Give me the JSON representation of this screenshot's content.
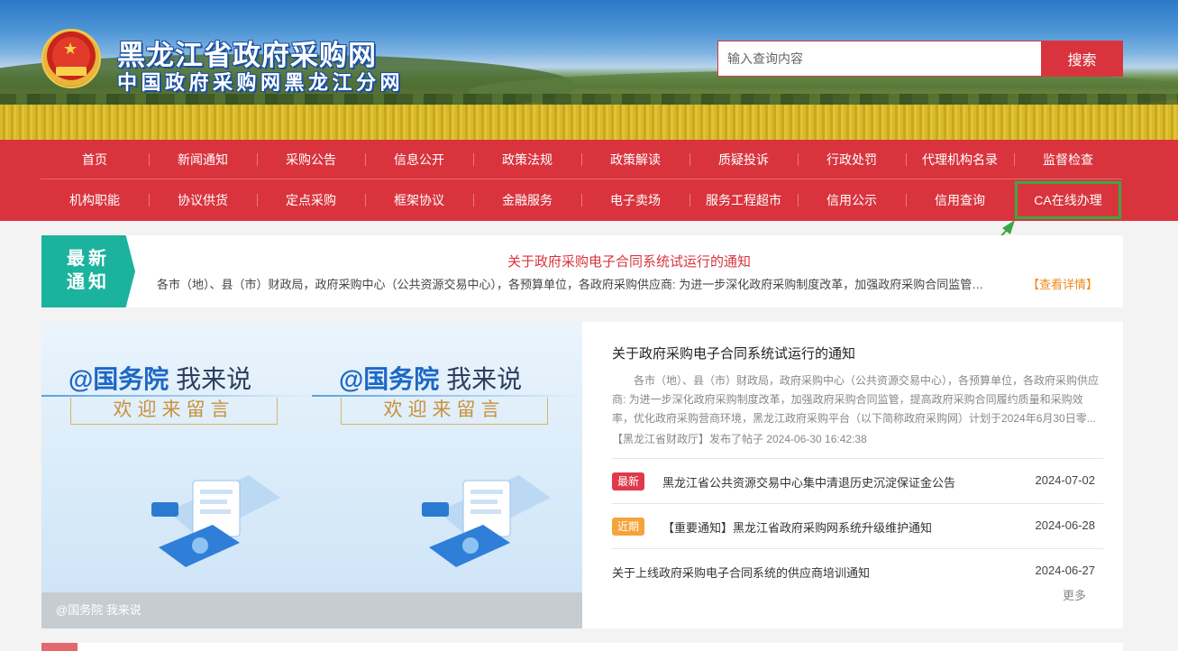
{
  "header": {
    "site_title": "黑龙江省政府采购网",
    "site_subtitle": "中国政府采购网黑龙江分网",
    "search_placeholder": "输入查询内容",
    "search_button": "搜索"
  },
  "nav": {
    "row1": [
      "首页",
      "新闻通知",
      "采购公告",
      "信息公开",
      "政策法规",
      "政策解读",
      "质疑投诉",
      "行政处罚",
      "代理机构名录",
      "监督检查"
    ],
    "row2": [
      "机构职能",
      "协议供货",
      "定点采购",
      "框架协议",
      "金融服务",
      "电子卖场",
      "服务工程超市",
      "信用公示",
      "信用查询",
      "CA在线办理"
    ]
  },
  "notice": {
    "tag_line1": "最新",
    "tag_line2": "通知",
    "title": "关于政府采购电子合同系统试运行的通知",
    "body": "各市（地）、县（市）财政局，政府采购中心（公共资源交易中心），各预算单位，各政府采购供应商: 为进一步深化政府采购制度改革，加强政府采购合同监管，提高政府采购合同履约质量和采购效率",
    "more": "【查看详情】"
  },
  "slider": {
    "title_main": "@国务院",
    "title_rest": " 我来说",
    "subtitle": "欢迎来留言",
    "caption": "@国务院 我来说"
  },
  "news": {
    "headline": "关于政府采购电子合同系统试运行的通知",
    "summary": "各市（地）、县（市）财政局，政府采购中心（公共资源交易中心），各预算单位，各政府采购供应商: 为进一步深化政府采购制度改革，加强政府采购合同监管，提高政府采购合同履约质量和采购效率，优化政府采购营商环境，黑龙江政府采购平台（以下简称政府采购网）计划于2024年6月30日零...",
    "meta": "【黑龙江省财政厅】发布了帖子  2024-06-30 16:42:38",
    "items": [
      {
        "badge": "最新",
        "badge_color": "#e0394a",
        "title": "黑龙江省公共资源交易中心集中清退历史沉淀保证金公告",
        "date": "2024-07-02"
      },
      {
        "badge": "近期",
        "badge_color": "#f5a43a",
        "title": "【重要通知】黑龙江省政府采购网系统升级维护通知",
        "date": "2024-06-28"
      },
      {
        "badge": "",
        "badge_color": "",
        "title": "关于上线政府采购电子合同系统的供应商培训通知",
        "date": "2024-06-27"
      }
    ],
    "more": "更多"
  },
  "colors": {
    "brand_red": "#d9343e",
    "notice_teal": "#1bb39d",
    "highlight_green": "#3aa845",
    "notice_more_orange": "#f08a1c"
  }
}
